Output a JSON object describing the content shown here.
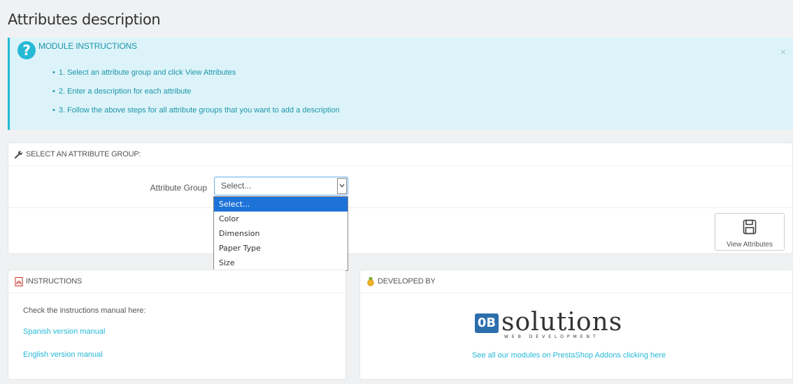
{
  "page": {
    "title": "Attributes description"
  },
  "alert": {
    "title": "MODULE INSTRUCTIONS",
    "icon": "question-circle-icon",
    "close": "×",
    "items": [
      "1. Select an attribute group and click View Attributes",
      "2. Enter a description for each attribute",
      "3. Follow the above steps for all attribute groups that you want to add a description"
    ]
  },
  "select_panel": {
    "heading": "SELECT AN ATTRIBUTE GROUP:",
    "label": "Attribute Group",
    "selected": "Select...",
    "options": [
      "Select...",
      "Color",
      "Dimension",
      "Paper Type",
      "Size"
    ],
    "button_label": "View Attributes"
  },
  "instructions": {
    "heading": "INSTRUCTIONS",
    "text": "Check the instructions manual here:",
    "link_es": "Spanish version manual",
    "link_en": "English version manual"
  },
  "developed": {
    "heading": "DEVELOPED BY",
    "logo_badge": "0B",
    "logo_word": "solutions",
    "logo_sub": "WEB DEVELOPMENT",
    "link": "See all our modules on PrestaShop Addons clicking here"
  },
  "colors": {
    "accent": "#25b9d7",
    "alert_bg": "#dcf4f9",
    "selected_option": "#1e73d8"
  }
}
